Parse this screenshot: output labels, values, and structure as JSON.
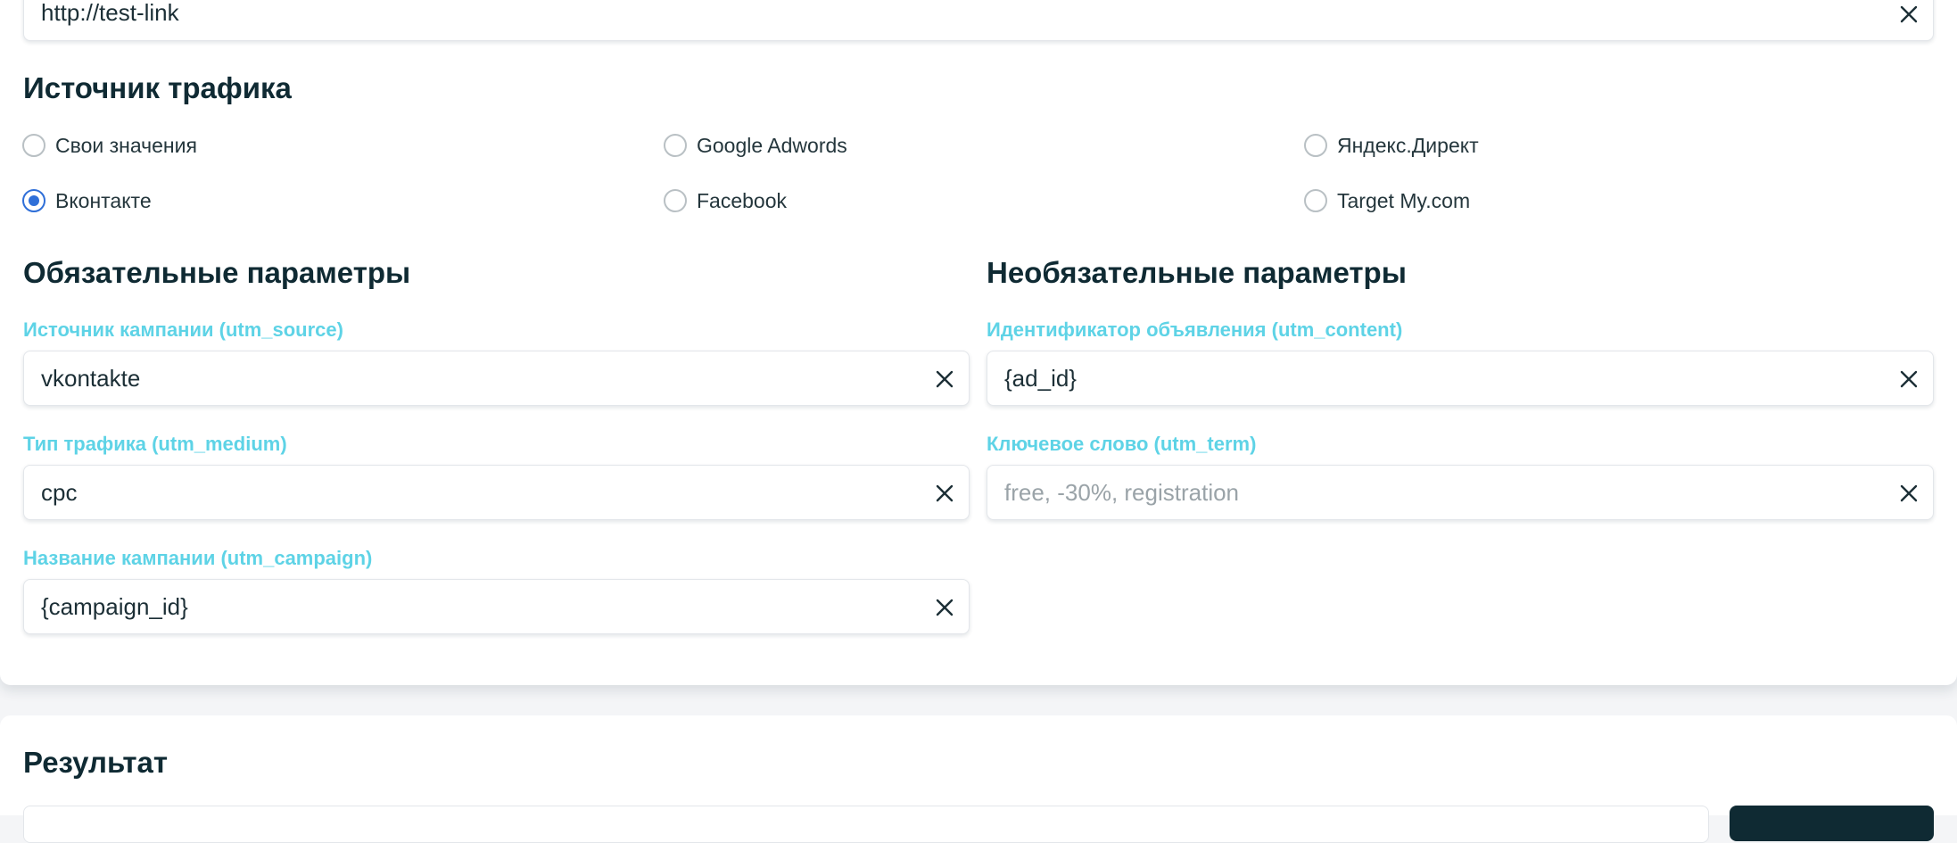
{
  "url_field": {
    "value": "http://test-link"
  },
  "traffic_source": {
    "title": "Источник трафика",
    "options": [
      {
        "label": "Свои значения",
        "checked": false
      },
      {
        "label": "Google Adwords",
        "checked": false
      },
      {
        "label": "Яндекс.Директ",
        "checked": false
      },
      {
        "label": "Вконтакте",
        "checked": true
      },
      {
        "label": "Facebook",
        "checked": false
      },
      {
        "label": "Target My.com",
        "checked": false
      }
    ]
  },
  "required_params": {
    "title": "Обязательные параметры",
    "fields": [
      {
        "label": "Источник кампании (utm_source)",
        "value": "vkontakte"
      },
      {
        "label": "Тип трафика (utm_medium)",
        "value": "cpc"
      },
      {
        "label": "Название кампании (utm_campaign)",
        "value": "{campaign_id}"
      }
    ]
  },
  "optional_params": {
    "title": "Необязательные параметры",
    "fields": [
      {
        "label": "Идентификатор объявления (utm_content)",
        "value": "{ad_id}",
        "placeholder": ""
      },
      {
        "label": "Ключевое слово (utm_term)",
        "value": "",
        "placeholder": "free, -30%, registration"
      }
    ]
  },
  "result": {
    "title": "Результат"
  },
  "colors": {
    "accent_label": "#5ed3e6",
    "radio_checked": "#2f6fd8",
    "heading": "#0f2a33",
    "dark_button": "#0f2a33"
  },
  "icons": {
    "clear": "close-icon",
    "radio": "radio-icon"
  }
}
